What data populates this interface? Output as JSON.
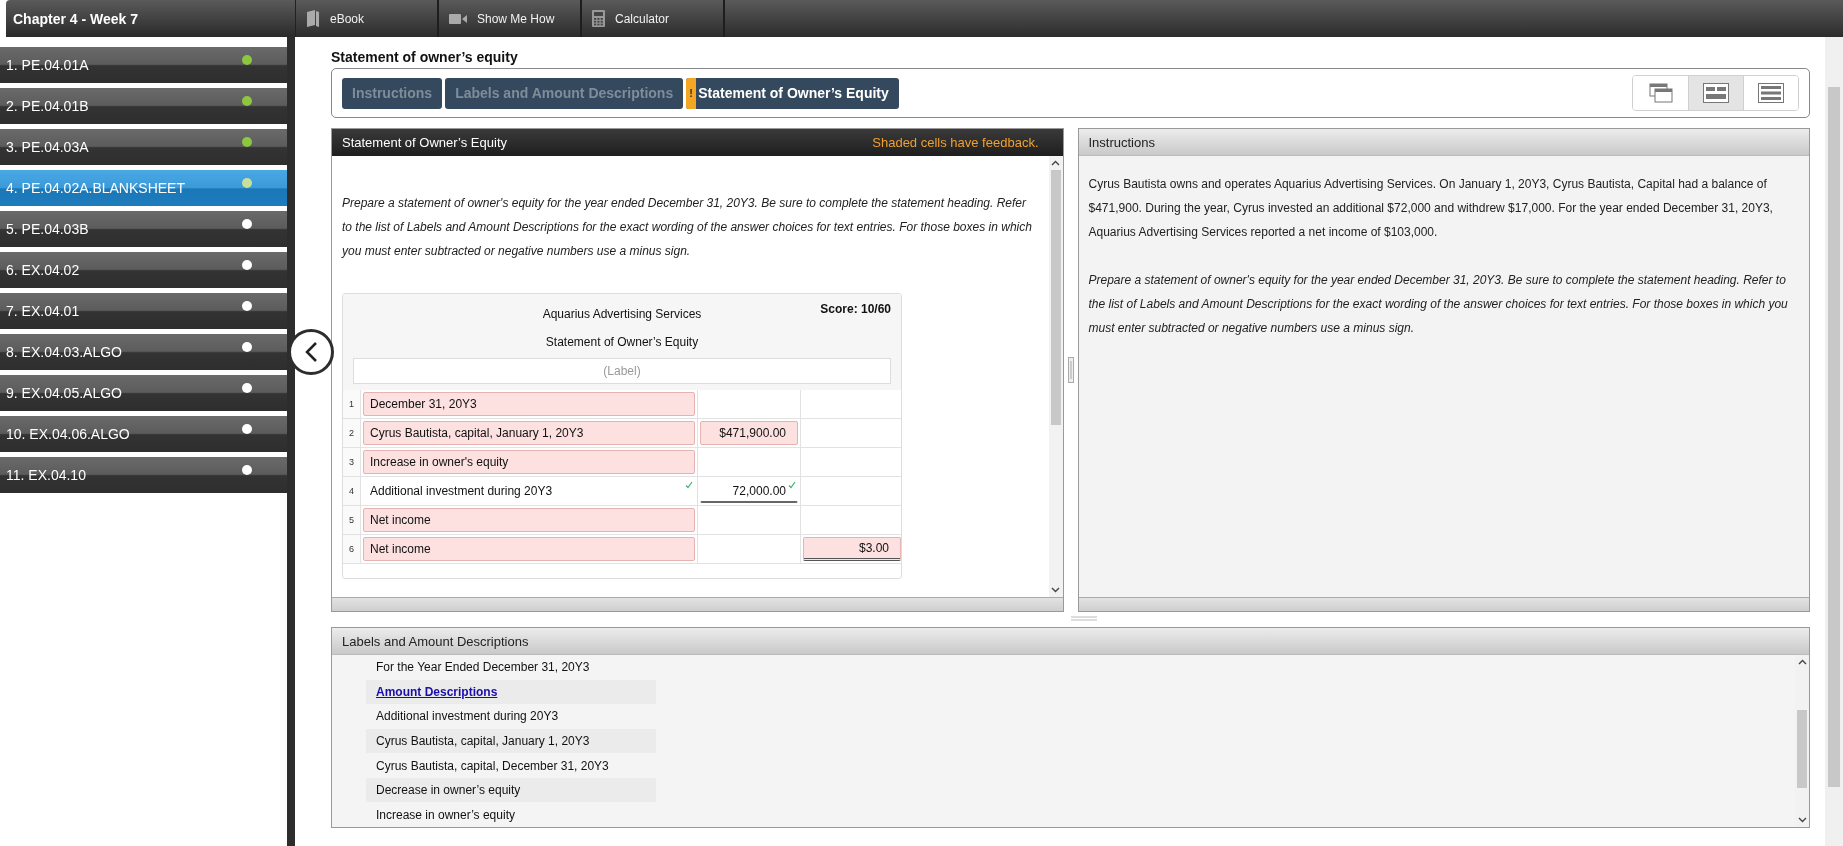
{
  "sidebar": {
    "title": "Chapter 4 - Week 7",
    "items": [
      {
        "label": "1. PE.04.01A",
        "color": "#8dc63f",
        "selected": false
      },
      {
        "label": "2. PE.04.01B",
        "color": "#8dc63f",
        "selected": false
      },
      {
        "label": "3. PE.04.03A",
        "color": "#8dc63f",
        "selected": false
      },
      {
        "label": "4. PE.04.02A.BLANKSHEET",
        "color": "#c8e09a",
        "selected": true
      },
      {
        "label": "5. PE.04.03B",
        "color": "#ffffff",
        "selected": false
      },
      {
        "label": "6. EX.04.02",
        "color": "#ffffff",
        "selected": false
      },
      {
        "label": "7. EX.04.01",
        "color": "#ffffff",
        "selected": false
      },
      {
        "label": "8. EX.04.03.ALGO",
        "color": "#ffffff",
        "selected": false
      },
      {
        "label": "9. EX.04.05.ALGO",
        "color": "#ffffff",
        "selected": false
      },
      {
        "label": "10. EX.04.06.ALGO",
        "color": "#ffffff",
        "selected": false
      },
      {
        "label": "11. EX.04.10",
        "color": "#ffffff",
        "selected": false
      }
    ]
  },
  "toolbar": {
    "buttons": [
      {
        "label": "eBook",
        "kind": "book"
      },
      {
        "label": "Show Me How",
        "kind": "video"
      },
      {
        "label": "Calculator",
        "kind": "calculator"
      }
    ]
  },
  "page_title": "Statement of owner’s equity",
  "tabs": [
    {
      "label": "Instructions",
      "selected": false
    },
    {
      "label": "Labels and Amount Descriptions",
      "selected": false
    },
    {
      "label": "Statement of Owner’s Equity",
      "selected": true,
      "flag": "!"
    }
  ],
  "view_modes": [
    {
      "kind": "stacked",
      "selected": false
    },
    {
      "kind": "split",
      "selected": true
    },
    {
      "kind": "rows",
      "selected": false
    }
  ],
  "worksheet_panel": {
    "title": "Statement of Owner’s Equity",
    "notice": "Shaded cells have feedback.",
    "instructions": "Prepare a statement of owner's equity for the year ended December 31, 20Y3. Be sure to complete the statement heading. Refer to the list of Labels and Amount Descriptions for the exact wording of the answer choices for text entries. For those boxes in which you must enter subtracted or negative numbers use a minus sign.",
    "worksheet": {
      "company": "Aquarius Advertising Services",
      "statement": "Statement of Owner’s Equity",
      "score": "Score: 10/60",
      "label_placeholder": "(Label)",
      "rows": [
        {
          "number": "1",
          "label": {
            "value": "December 31, 20Y3",
            "shaded": true,
            "correct": false
          }
        },
        {
          "number": "2",
          "label": {
            "value": "Cyrus Bautista, capital, January 1, 20Y3",
            "shaded": true,
            "correct": false
          },
          "amount": {
            "value": "$471,900.00",
            "shaded": true,
            "correct": false,
            "underlined": false
          }
        },
        {
          "number": "3",
          "label": {
            "value": "Increase in owner's equity",
            "shaded": true,
            "correct": false
          }
        },
        {
          "number": "4",
          "label": {
            "value": "Additional investment during 20Y3",
            "shaded": false,
            "correct": true
          },
          "amount": {
            "value": "72,000.00",
            "shaded": false,
            "correct": true,
            "underlined": true
          }
        },
        {
          "number": "5",
          "label": {
            "value": "Net income",
            "shaded": true,
            "correct": false
          }
        },
        {
          "number": "6",
          "label": {
            "value": "Net income",
            "shaded": true,
            "correct": false
          },
          "total": {
            "value": "$3.00",
            "shaded": true,
            "correct": false,
            "underlined": true
          }
        }
      ]
    }
  },
  "instructions_panel": {
    "title": "Instructions",
    "paragraphs": [
      {
        "text": "Cyrus Bautista owns and operates Aquarius Advertising Services. On January 1, 20Y3, Cyrus Bautista, Capital had a balance of $471,900. During the year, Cyrus invested an additional $72,000 and withdrew $17,000. For the year ended December 31, 20Y3, Aquarius Advertising Services reported a net income of $103,000.",
        "italic": false
      },
      {
        "text": "Prepare a statement of owner's equity for the year ended December 31, 20Y3. Be sure to complete the statement heading. Refer to the list of Labels and Amount Descriptions for the exact wording of the answer choices for text entries. For those boxes in which you must enter subtracted or negative numbers use a minus sign.",
        "italic": true
      }
    ]
  },
  "labels_panel": {
    "title": "Labels and Amount Descriptions",
    "items": [
      {
        "text": "For the Year Ended December 31, 20Y3",
        "kind": "entry"
      },
      {
        "text": "Amount Descriptions",
        "kind": "heading"
      },
      {
        "text": "Additional investment during 20Y3",
        "kind": "entry"
      },
      {
        "text": "Cyrus Bautista, capital, January 1, 20Y3",
        "kind": "entry"
      },
      {
        "text": "Cyrus Bautista, capital, December 31, 20Y3",
        "kind": "entry"
      },
      {
        "text": "Decrease in owner’s equity",
        "kind": "entry"
      },
      {
        "text": "Increase in owner’s equity",
        "kind": "entry"
      }
    ]
  }
}
